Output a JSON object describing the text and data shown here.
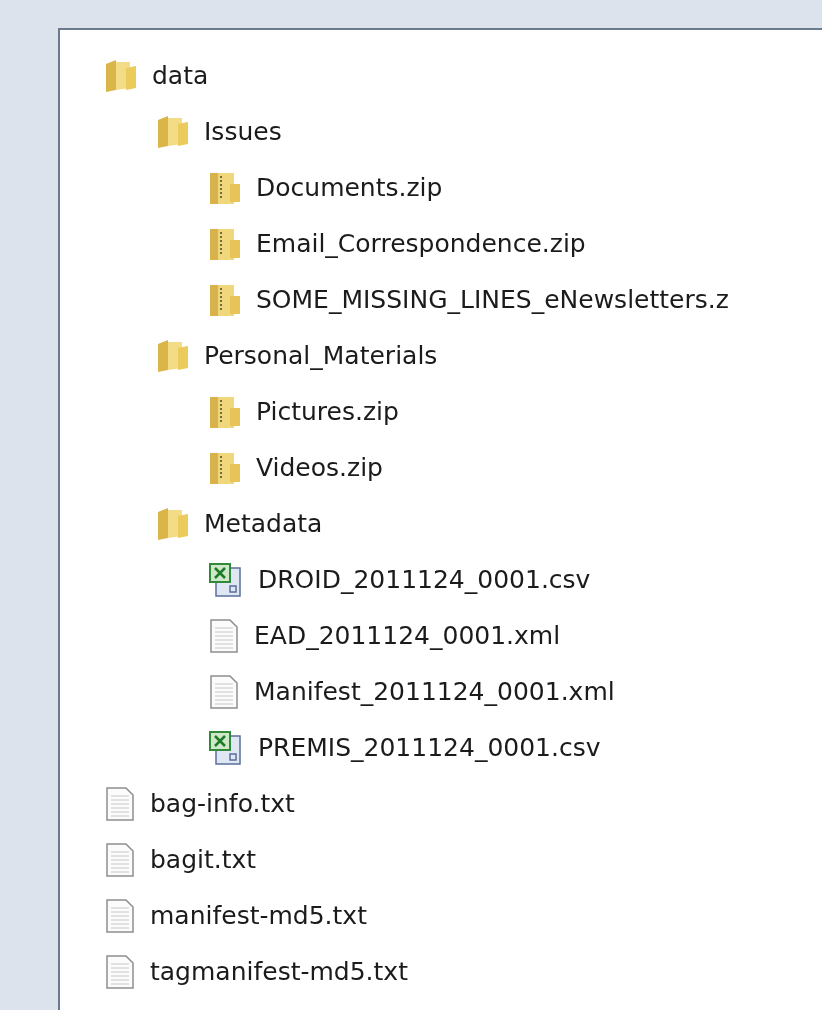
{
  "tree": [
    {
      "label": "data",
      "kind": "folder",
      "children": [
        {
          "label": "Issues",
          "kind": "folder",
          "children": [
            {
              "label": "Documents.zip",
              "kind": "zip"
            },
            {
              "label": "Email_Correspondence.zip",
              "kind": "zip"
            },
            {
              "label": "SOME_MISSING_LINES_eNewsletters.z",
              "kind": "zip"
            }
          ]
        },
        {
          "label": "Personal_Materials",
          "kind": "folder",
          "children": [
            {
              "label": "Pictures.zip",
              "kind": "zip"
            },
            {
              "label": "Videos.zip",
              "kind": "zip"
            }
          ]
        },
        {
          "label": "Metadata",
          "kind": "folder",
          "children": [
            {
              "label": "DROID_2011124_0001.csv",
              "kind": "spreadsheet"
            },
            {
              "label": "EAD_2011124_0001.xml",
              "kind": "text"
            },
            {
              "label": "Manifest_2011124_0001.xml",
              "kind": "text"
            },
            {
              "label": "PREMIS_2011124_0001.csv",
              "kind": "spreadsheet"
            }
          ]
        }
      ]
    },
    {
      "label": "bag-info.txt",
      "kind": "text"
    },
    {
      "label": "bagit.txt",
      "kind": "text"
    },
    {
      "label": "manifest-md5.txt",
      "kind": "text"
    },
    {
      "label": "tagmanifest-md5.txt",
      "kind": "text"
    }
  ]
}
